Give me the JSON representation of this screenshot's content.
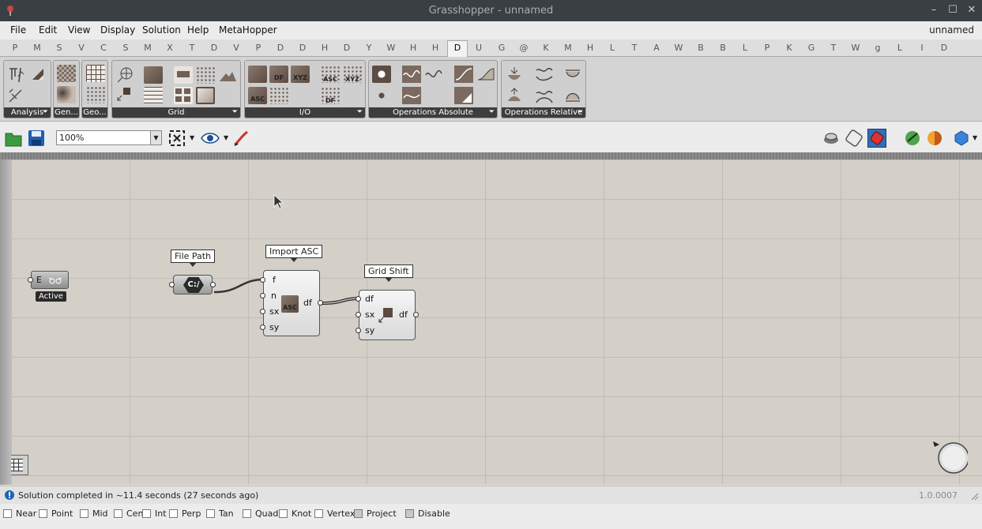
{
  "window": {
    "title": "Grasshopper - unnamed",
    "minimize": "–",
    "maximize": "☐",
    "close": "✕"
  },
  "menu": {
    "items": [
      "File",
      "Edit",
      "View",
      "Display",
      "Solution",
      "Help",
      "MetaHopper"
    ],
    "doc_name": "unnamed"
  },
  "tabs": {
    "items": [
      "P",
      "M",
      "S",
      "V",
      "C",
      "S",
      "M",
      "X",
      "T",
      "D",
      "V",
      "P",
      "D",
      "D",
      "H",
      "D",
      "Y",
      "W",
      "H",
      "H",
      "D",
      "U",
      "G",
      "@",
      "K",
      "M",
      "H",
      "L",
      "T",
      "A",
      "W",
      "B",
      "B",
      "L",
      "P",
      "K",
      "G",
      "T",
      "W",
      "g",
      "L",
      "I",
      "D"
    ],
    "active_index": 20
  },
  "ribbon": {
    "panels": [
      {
        "label": "Analysis",
        "has_arrow": true
      },
      {
        "label": "Gen...",
        "has_arrow": false
      },
      {
        "label": "Geo...",
        "has_arrow": false
      },
      {
        "label": "Grid",
        "has_arrow": true
      },
      {
        "label": "I/O",
        "has_arrow": true
      },
      {
        "label": "Operations Absolute",
        "has_arrow": true
      },
      {
        "label": "Operations Relative",
        "has_arrow": true
      }
    ],
    "icon_texts": {
      "df": "DF",
      "xyz": "XYZ",
      "asc": "ASC",
      "asc2": "ASC",
      "xyz2": "XYZ",
      "df2": "DF"
    }
  },
  "toolbar": {
    "zoom": "100%",
    "zoom_options_icon": "dropdown-arrow"
  },
  "canvas": {
    "nodes": [
      {
        "id": "active-param",
        "label": "E",
        "badge": "Active"
      },
      {
        "id": "file-path",
        "tag": "File Path",
        "body": "C:/"
      },
      {
        "id": "import-asc",
        "tag": "Import ASC",
        "inputs": [
          "f",
          "n",
          "sx",
          "sy"
        ],
        "outputs": [
          "df"
        ],
        "icon_text": "ASC"
      },
      {
        "id": "grid-shift",
        "tag": "Grid Shift",
        "inputs": [
          "df",
          "sx",
          "sy"
        ],
        "outputs": [
          "df"
        ]
      }
    ]
  },
  "status": {
    "message": "Solution completed in ~11.4 seconds (27 seconds ago)",
    "version": "1.0.0007"
  },
  "snaps": {
    "items": [
      "Near",
      "Point",
      "Mid",
      "Cen",
      "Int",
      "Perp",
      "Tan",
      "Quad",
      "Knot",
      "Vertex",
      "Project",
      "Disable"
    ]
  },
  "colors": {
    "titlebar": "#3a3f44",
    "canvas": "#d4d0c8",
    "ribbon_label": "#3d3d3d",
    "accent_blue": "#1e63b8"
  }
}
